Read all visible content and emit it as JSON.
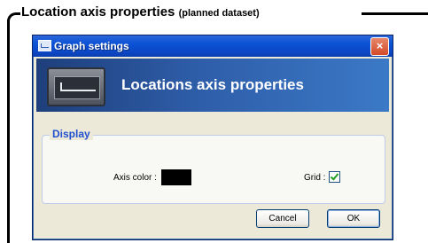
{
  "caption": {
    "main": "Location axis properties",
    "sub": "(planned dataset)"
  },
  "window": {
    "title": "Graph settings",
    "close_glyph": "×",
    "banner_title": "Locations axis properties",
    "banner_icon": "axis-graph-icon"
  },
  "display": {
    "group_title": "Display",
    "axis_color_label": "Axis color :",
    "axis_color_value": "#000000",
    "grid_label": "Grid :",
    "grid_checked": true
  },
  "buttons": {
    "cancel": "Cancel",
    "ok": "OK"
  }
}
